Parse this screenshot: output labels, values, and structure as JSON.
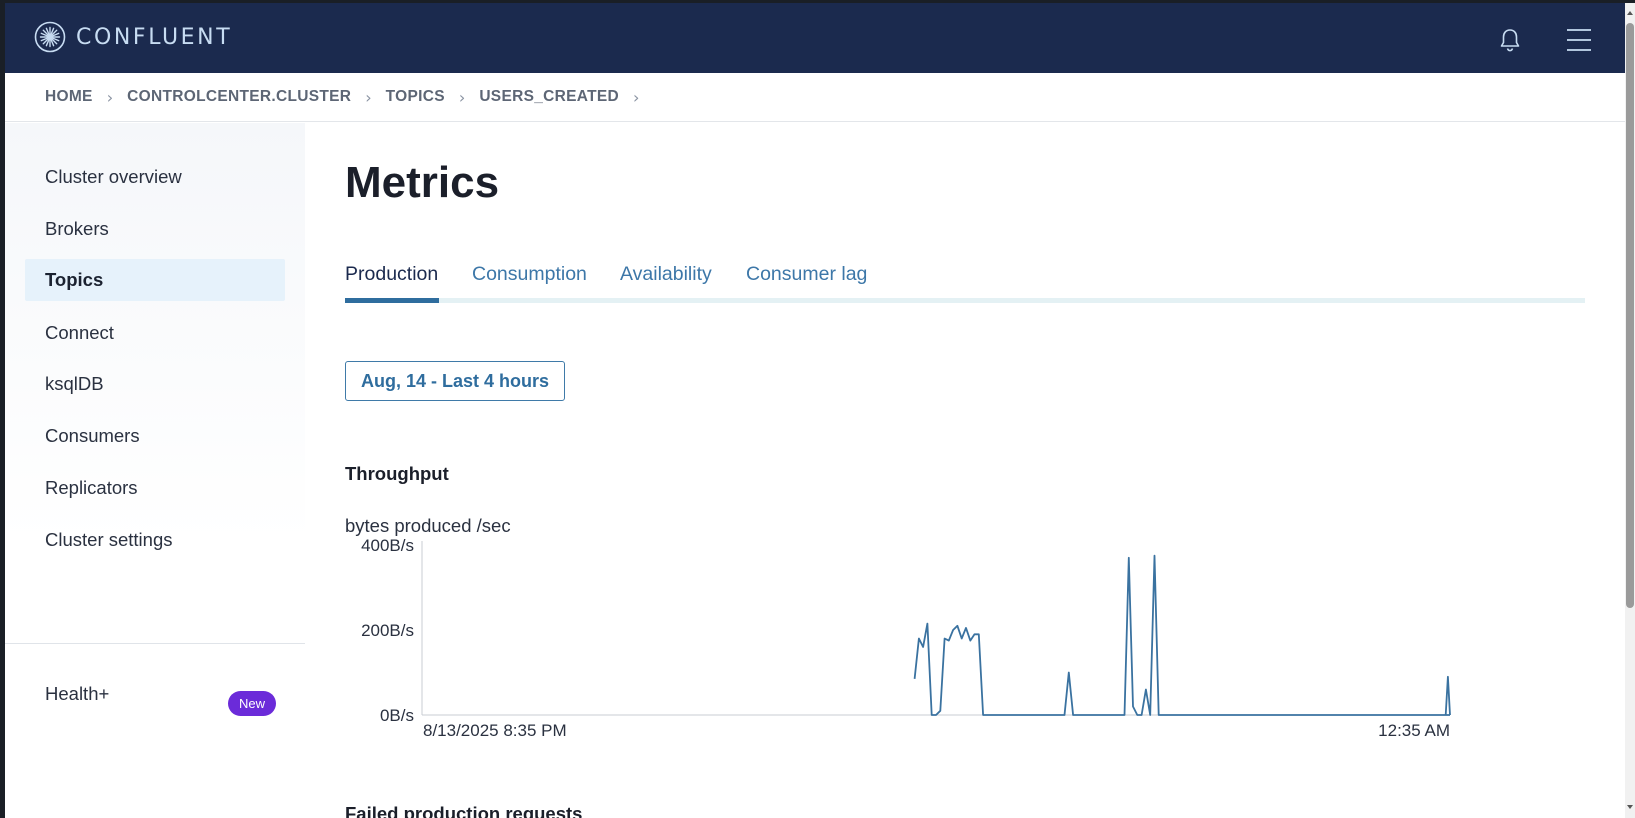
{
  "brand": {
    "name": "CONFLUENT"
  },
  "breadcrumb": [
    "HOME",
    "CONTROLCENTER.CLUSTER",
    "TOPICS",
    "USERS_CREATED"
  ],
  "sidebar": {
    "items": [
      {
        "label": "Cluster overview",
        "active": false
      },
      {
        "label": "Brokers",
        "active": false
      },
      {
        "label": "Topics",
        "active": true
      },
      {
        "label": "Connect",
        "active": false
      },
      {
        "label": "ksqlDB",
        "active": false
      },
      {
        "label": "Consumers",
        "active": false
      },
      {
        "label": "Replicators",
        "active": false
      },
      {
        "label": "Cluster settings",
        "active": false
      }
    ],
    "health": {
      "label": "Health+",
      "badge": "New"
    }
  },
  "page": {
    "title": "Metrics",
    "tabs": [
      {
        "label": "Production",
        "active": true
      },
      {
        "label": "Consumption",
        "active": false
      },
      {
        "label": "Availability",
        "active": false
      },
      {
        "label": "Consumer lag",
        "active": false
      }
    ],
    "date_range": "Aug, 14 - Last 4 hours",
    "section_title": "Throughput",
    "chart_label": "bytes produced /sec",
    "next_section_title": "Failed production requests"
  },
  "colors": {
    "topbar": "#1b2a4e",
    "accent": "#2f6d9e",
    "badge": "#6b2bd9",
    "line": "#3a72a0"
  },
  "icons": {
    "logo": "confluent-logo-icon",
    "notifications": "bell-icon",
    "menu": "hamburger-menu-icon"
  },
  "chart_data": {
    "type": "line",
    "xlabel": "",
    "ylabel": "",
    "x_tick_labels": [
      "8/13/2025 8:35 PM",
      "12:35 AM"
    ],
    "y_tick_labels": [
      "400B/s",
      "200B/s",
      "0B/s"
    ],
    "ylim": [
      0,
      400
    ],
    "x_range_minutes": [
      0,
      240
    ],
    "series": [
      {
        "x": [
          115,
          116,
          117,
          118,
          119,
          120,
          121,
          122,
          123,
          124,
          125,
          126,
          127,
          128,
          129,
          130,
          131,
          132,
          133,
          134,
          150,
          151,
          152,
          153,
          164,
          165,
          166,
          167,
          168,
          169,
          170,
          171,
          172,
          240
        ],
        "y": [
          85,
          180,
          160,
          215,
          0,
          0,
          10,
          180,
          175,
          200,
          210,
          180,
          205,
          175,
          190,
          190,
          0,
          0,
          0,
          0,
          0,
          100,
          0,
          0,
          0,
          370,
          20,
          0,
          0,
          60,
          0,
          375,
          0,
          0
        ]
      },
      {
        "x": [
          239,
          239.5,
          240
        ],
        "y": [
          0,
          90,
          0
        ]
      }
    ]
  }
}
